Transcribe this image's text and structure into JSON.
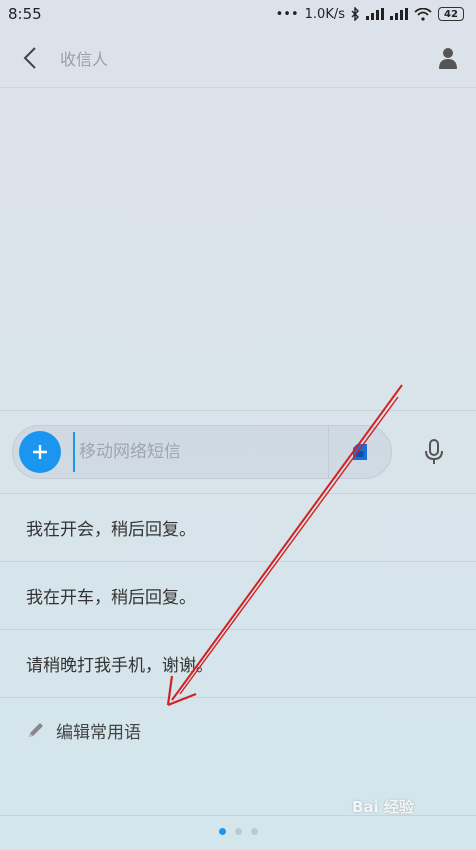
{
  "status_bar": {
    "time": "8:55",
    "network_speed": "1.0K/s",
    "battery_level": "42",
    "icons": [
      "dots-icon",
      "bluetooth-icon",
      "signal-icon",
      "signal-icon",
      "wifi-icon",
      "battery-icon"
    ]
  },
  "header": {
    "title": "收信人",
    "icons": [
      "back-arrow-icon",
      "contact-icon"
    ]
  },
  "compose": {
    "placeholder": "移动网络短信",
    "icons": [
      "plus-icon",
      "sim-card-icon",
      "microphone-icon"
    ],
    "accent_color": "#1a96f0"
  },
  "quick_replies": {
    "items": [
      {
        "label": "我在开会，稍后回复。"
      },
      {
        "label": "我在开车，稍后回复。"
      },
      {
        "label": "请稍晚打我手机，谢谢。"
      }
    ],
    "edit_label": "编辑常用语",
    "edit_icon": "pencil-icon"
  },
  "pager": {
    "total": 3,
    "active": 1
  },
  "watermark": {
    "text": "Bai 经验"
  },
  "annotation": {
    "arrow_color": "#d42020"
  }
}
